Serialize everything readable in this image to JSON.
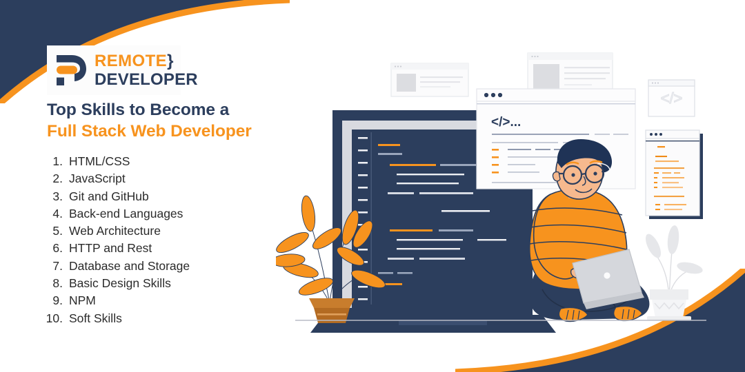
{
  "theme": {
    "navy": "#2C3E5D",
    "navy_dark": "#253452",
    "orange": "#F7931E",
    "orange_light": "#F9A94A",
    "background": "#FFFFFF",
    "text": "#2B2B2B",
    "card_gray": "#DCDDE1",
    "skin": "#F6B98E",
    "pot_brown": "#C87D2D"
  },
  "brand": {
    "logo_mark": "r-monogram-icon",
    "name_top": "REMOTE",
    "name_top_brace": "}",
    "name_bottom": "DEVELOPER"
  },
  "headline": {
    "line1": "Top Skills to Become a",
    "line2": "Full Stack Web Developer"
  },
  "skills": [
    {
      "num": "1.",
      "label": "HTML/CSS"
    },
    {
      "num": "2.",
      "label": "JavaScript"
    },
    {
      "num": "3.",
      "label": "Git and GitHub"
    },
    {
      "num": "4.",
      "label": "Back-end Languages"
    },
    {
      "num": "5.",
      "label": "Web Architecture"
    },
    {
      "num": "6.",
      "label": "HTTP and Rest"
    },
    {
      "num": "7.",
      "label": "Database and Storage"
    },
    {
      "num": "8.",
      "label": "Basic Design Skills"
    },
    {
      "num": "9.",
      "label": "NPM"
    },
    {
      "num": "10.",
      "label": "Soft Skills"
    }
  ],
  "illustration": {
    "code_window": {
      "dots_icon": "window-dots-icon",
      "heading": "</>..."
    },
    "small_card_code_glyph": "</>",
    "elements": [
      "large-monitor-code-editor",
      "floating-code-browser-window",
      "background-article-card-left",
      "background-article-card-right",
      "code-glyph-card",
      "orange-code-list-card",
      "seated-developer-with-laptop",
      "orange-leaf-plant",
      "gray-leaf-plant",
      "floor-line"
    ]
  }
}
